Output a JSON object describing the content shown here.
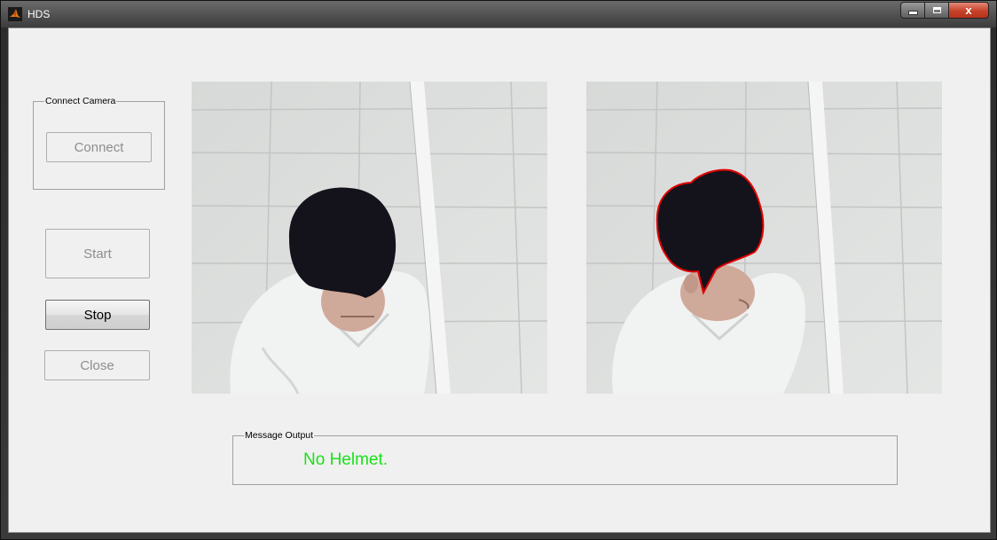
{
  "window": {
    "title": "HDS",
    "controls": {
      "minimize_icon": "minimize-icon",
      "maximize_icon": "maximize-icon",
      "close_label": "x"
    }
  },
  "connect_group": {
    "legend": "Connect Camera",
    "connect_button": "Connect"
  },
  "controls": {
    "start_button": "Start",
    "stop_button": "Stop",
    "close_button": "Close"
  },
  "message_group": {
    "legend": "Message Output",
    "message": "No Helmet.",
    "message_color": "#19e119"
  },
  "panels": {
    "left": {
      "content": "camera-frame"
    },
    "right": {
      "content": "detection-frame",
      "outline_color": "#e00000"
    }
  },
  "colors": {
    "background": "#f0f0f0",
    "titlebar": "#3c3c3c",
    "close_button": "#c6412a"
  }
}
